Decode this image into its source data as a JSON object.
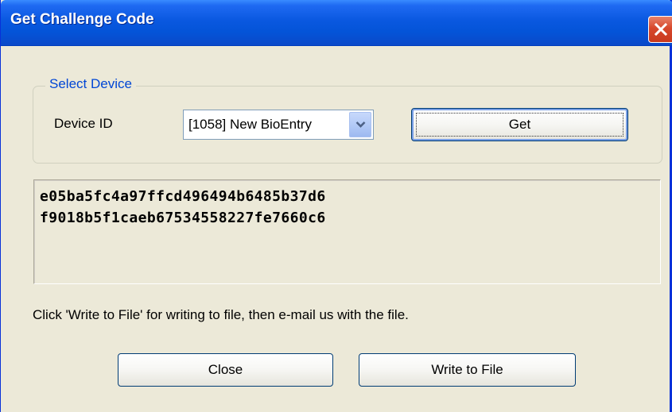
{
  "window": {
    "title": "Get Challenge Code",
    "close_icon": "close-icon",
    "accent_color": "#0a58e0",
    "close_color": "#d7482c"
  },
  "select_device": {
    "legend": "Select Device",
    "label": "Device ID",
    "selected_device": "[1058] New BioEntry",
    "dropdown_icon": "chevron-down-icon",
    "get_label": "Get"
  },
  "challenge_code": {
    "lines": [
      "e05ba5fc4a97ffcd496494b6485b37d6",
      "f9018b5f1caeb67534558227fe7660c6"
    ]
  },
  "instruction": "Click 'Write to File' for writing to file, then e-mail us with the file.",
  "buttons": {
    "close_label": "Close",
    "write_label": "Write to File"
  }
}
